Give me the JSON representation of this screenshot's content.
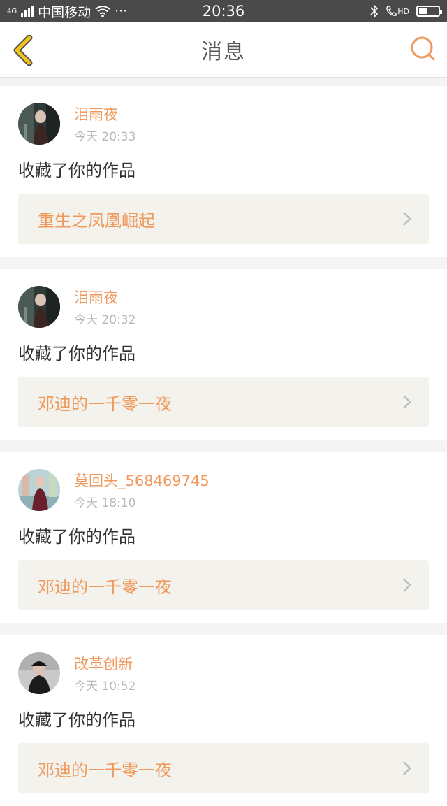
{
  "status_bar": {
    "network_tag": "4G",
    "carrier": "中国移动",
    "more": "···",
    "time": "20:36",
    "hd": "HD",
    "battery_level": 0.35
  },
  "header": {
    "title": "消息"
  },
  "messages": [
    {
      "username": "泪雨夜",
      "time": "今天 20:33",
      "action": "收藏了你的作品",
      "work": "重生之凤凰崛起",
      "avatar": "avatar-photo-1"
    },
    {
      "username": "泪雨夜",
      "time": "今天 20:32",
      "action": "收藏了你的作品",
      "work": "邓迪的一千零一夜",
      "avatar": "avatar-photo-1"
    },
    {
      "username": "莫回头_568469745",
      "time": "今天 18:10",
      "action": "收藏了你的作品",
      "work": "邓迪的一千零一夜",
      "avatar": "avatar-photo-2"
    },
    {
      "username": "改革创新",
      "time": "今天 10:52",
      "action": "收藏了你的作品",
      "work": "邓迪的一千零一夜",
      "avatar": "avatar-photo-3"
    }
  ],
  "colors": {
    "accent": "#ef9a5c",
    "back_icon": "#f2c21a",
    "status_bar": "#4a4a4a"
  }
}
